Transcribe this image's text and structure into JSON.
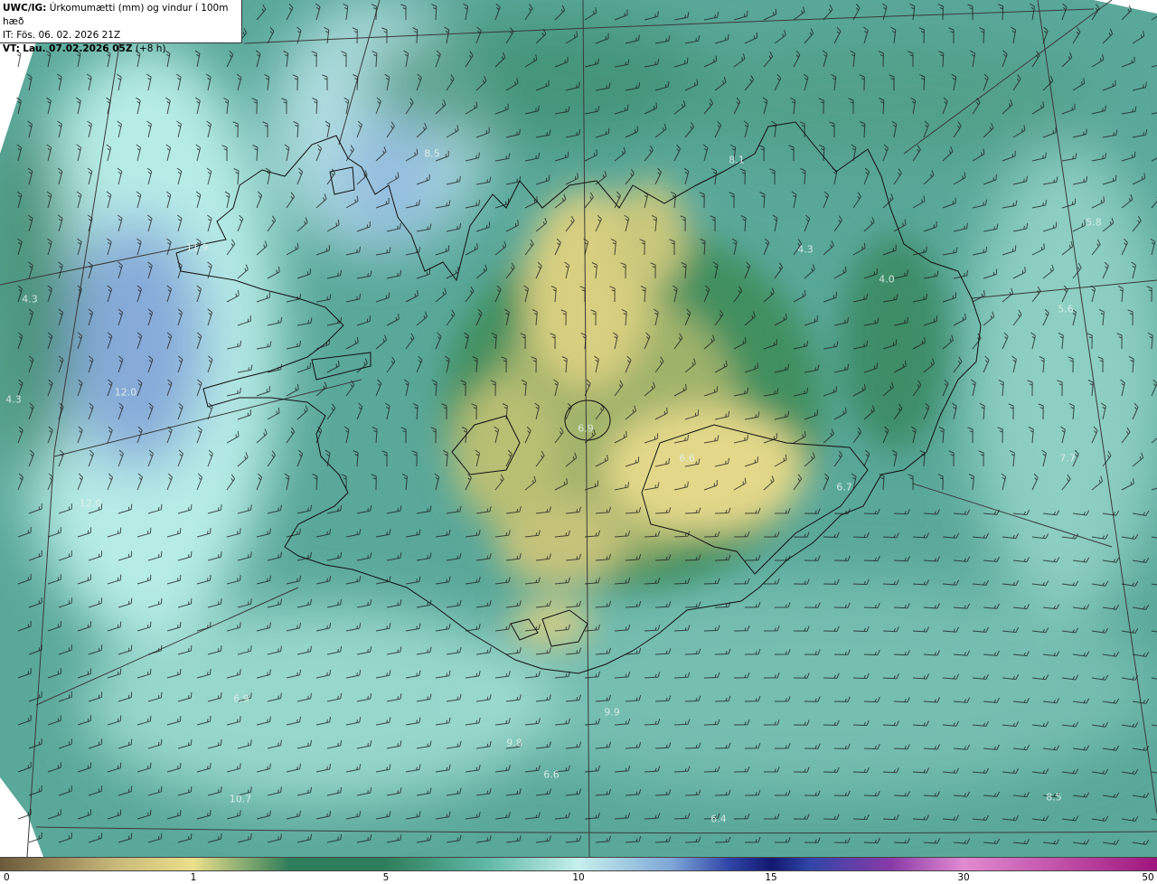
{
  "header": {
    "model": "UWC/IG:",
    "title": "Úrkomumætti (mm) og vindur í 100m hæð",
    "init_time": "IT: Fös. 06. 02. 2026 21Z",
    "valid_prefix": "VT:",
    "valid_time": "Lau. 07.02.2026 05Z",
    "valid_offset": "(+8 h)"
  },
  "value_labels": [
    "8.5",
    "8.1",
    "5.8",
    "11.9",
    "4.3",
    "4.3",
    "4.0",
    "5.6",
    "12.0",
    "4.3",
    "6.9",
    "6.6",
    "7.7",
    "12.0",
    "6.7",
    "6.9",
    "9.9",
    "9.8",
    "6.6",
    "10.7",
    "6.4",
    "8.5"
  ],
  "colorbar": {
    "ticks": [
      "0",
      "1",
      "5",
      "10",
      "15",
      "30",
      "50"
    ],
    "colors": {
      "low": "#6b5a3a",
      "tan": "#c8b97a",
      "yellow": "#ebe08a",
      "green": "#2f7d5a",
      "teal": "#5fb8a6",
      "cyan": "#c6f0ec",
      "lightblue": "#7fa7d8",
      "blue": "#3045a8",
      "navy": "#121870",
      "purple": "#8a3aa8",
      "pink": "#e28ad2",
      "magenta": "#a0157e"
    }
  },
  "map_colors": {
    "sea_base": "#5aa89a",
    "land_wet": "#2f7d5a",
    "land_dry": "#e3d889",
    "west_cyan": "#b7ece6",
    "west_blue": "#7f9fd6"
  }
}
